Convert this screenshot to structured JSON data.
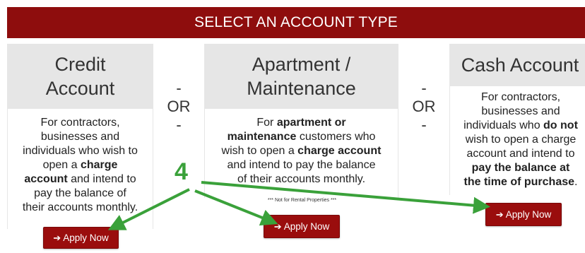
{
  "header": {
    "title": "SELECT AN ACCOUNT TYPE"
  },
  "cards": {
    "credit": {
      "title_l1": "Credit",
      "title_l2": "Account",
      "body_l1": "For contractors,",
      "body_l2": "businesses and",
      "body_l3": "individuals who wish to",
      "body_l4a": "open a ",
      "body_l4b": "charge",
      "body_l5a": "account",
      "body_l5b": " and intend to",
      "body_l6": "pay the balance of",
      "body_l7": "their accounts monthly.",
      "button": "Apply Now"
    },
    "apartment": {
      "title_l1": "Apartment /",
      "title_l2": "Maintenance",
      "body_l1a": "For ",
      "body_l1b": "apartment or",
      "body_l2a": "maintenance",
      "body_l2b": " customers who",
      "body_l3a": "wish to open a ",
      "body_l3b": "charge account",
      "body_l4": "and intend to pay the balance",
      "body_l5": "of their accounts monthly.",
      "note": "*** Not for Rental Properties ***",
      "button": "Apply Now"
    },
    "cash": {
      "title": "Cash Account",
      "body_l1": "For contractors,",
      "body_l2": "businesses and",
      "body_l3a": "individuals who ",
      "body_l3b": "do not",
      "body_l4": "wish to open a charge",
      "body_l5": "account and intend to",
      "body_l6": "pay the balance at",
      "body_l7": "the time of purchase",
      "body_l7_end": ".",
      "button": "Apply Now"
    }
  },
  "separators": {
    "dash": "-",
    "or": "OR"
  },
  "annotation": {
    "number": "4",
    "color": "#3aa13a"
  },
  "colors": {
    "brand": "#8e0d0d",
    "card_head": "#e6e6e6"
  },
  "icons": {
    "button_icon": "arrow-right-icon"
  }
}
